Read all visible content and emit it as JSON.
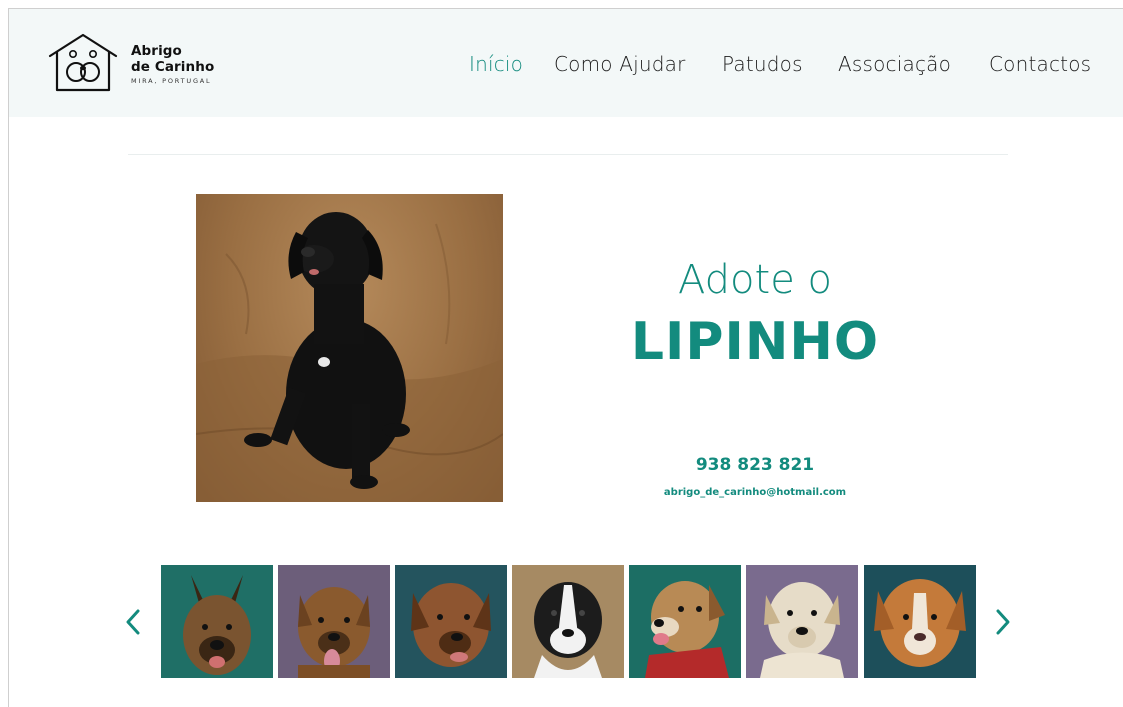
{
  "brand": {
    "line1": "Abrigo",
    "line2": "de Carinho",
    "subtitle": "MIRA, PORTUGAL",
    "logo_icon": "dog-house-icon"
  },
  "nav": {
    "items": [
      {
        "label": "Início",
        "active": true
      },
      {
        "label": "Como Ajudar",
        "active": false
      },
      {
        "label": "Patudos",
        "active": false
      },
      {
        "label": "Associação",
        "active": false
      },
      {
        "label": "Contactos",
        "active": false
      }
    ]
  },
  "hero": {
    "heading": "Adote o",
    "pet_name": "LIPINHO",
    "phone": "938 823 821",
    "email": "abrigo_de_carinho@hotmail.com",
    "photo_icon": "black-dog-photo"
  },
  "carousel": {
    "prev_icon": "chevron-left-icon",
    "next_icon": "chevron-right-icon",
    "thumbnails": [
      {
        "icon": "german-shepherd-photo",
        "bg": "#1f6f66",
        "fur": "#6b4a2c"
      },
      {
        "icon": "brown-dog-photo",
        "bg": "#6c5e7a",
        "fur": "#8a5a2e"
      },
      {
        "icon": "brown-dog-photo",
        "bg": "#24545e",
        "fur": "#8e5530"
      },
      {
        "icon": "black-white-dog-photo",
        "bg": "#a68a63",
        "fur": "#1c1c1c"
      },
      {
        "icon": "tan-dog-red-harness-photo",
        "bg": "#1c6e64",
        "fur": "#b88a55"
      },
      {
        "icon": "cream-dog-photo",
        "bg": "#7a6b8e",
        "fur": "#e6dcc8"
      },
      {
        "icon": "golden-dog-photo",
        "bg": "#1d4f5a",
        "fur": "#c47a3a"
      }
    ]
  },
  "colors": {
    "accent": "#138b7e",
    "header_bg": "#f3f8f8"
  }
}
